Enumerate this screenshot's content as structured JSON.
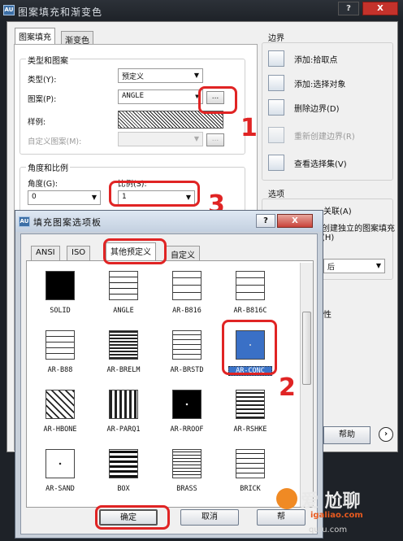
{
  "back_dialog": {
    "title": "图案填充和渐变色",
    "app_icon_text": "AU",
    "help_btn": "?",
    "close_btn": "X",
    "tabs": [
      "图案填充",
      "渐变色"
    ],
    "type_group": {
      "title": "类型和图案",
      "type_label": "类型(Y):",
      "type_value": "预定义",
      "pattern_label": "图案(P):",
      "pattern_value": "ANGLE",
      "browse_btn": "...",
      "sample_label": "样例:",
      "custom_label": "自定义图案(M):",
      "custom_btn": "..."
    },
    "angle_group": {
      "title": "角度和比例",
      "angle_label": "角度(G):",
      "angle_value": "0",
      "scale_label": "比例(S):",
      "scale_value": "1"
    },
    "boundary": {
      "title": "边界",
      "items": [
        "添加:拾取点",
        "添加:选择对象",
        "删除边界(D)",
        "重新创建边界(R)",
        "查看选择集(V)"
      ]
    },
    "options": {
      "title": "选项",
      "associative": "关联(A)",
      "independent": "创建独立的图案填充(H)",
      "draw_order_value": "后",
      "inherit": "性"
    },
    "help_button": "帮助"
  },
  "front_dialog": {
    "title": "填充图案选项板",
    "help_btn": "?",
    "close_btn": "X",
    "tabs": [
      "ANSI",
      "ISO",
      "其他预定义",
      "自定义"
    ],
    "patterns": [
      "SOLID",
      "ANGLE",
      "AR-B816",
      "AR-B816C",
      "AR-B88",
      "AR-BRELM",
      "AR-BRSTD",
      "AR-CONC",
      "AR-HBONE",
      "AR-PARQ1",
      "AR-RROOF",
      "AR-RSHKE",
      "AR-SAND",
      "BOX",
      "BRASS",
      "BRICK"
    ],
    "selected": "AR-CONC",
    "ok": "确定",
    "cancel": "取消",
    "help": "帮"
  },
  "annotations": [
    "1",
    "2",
    "3"
  ],
  "watermark": {
    "main": "爱 尬聊",
    "sub": "igaliao.com",
    "side": "qufu.com"
  },
  "colors": {
    "annotation": "#e02424",
    "selection": "#3b74c9"
  }
}
